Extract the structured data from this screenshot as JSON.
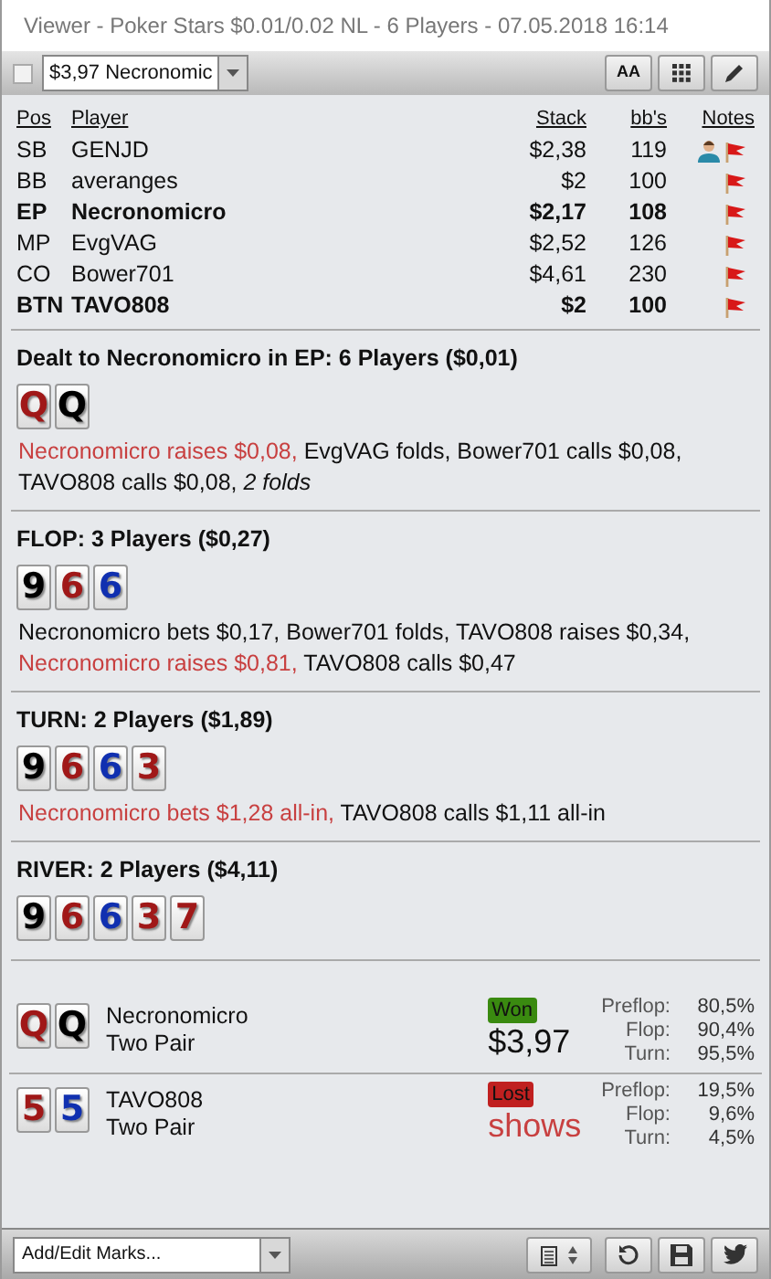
{
  "window": {
    "title": "Viewer - Poker Stars $0.01/0.02 NL - 6 Players - 07.05.2018 16:14"
  },
  "toolbar": {
    "checked": false,
    "hand_select": "$3,97 Necronomic",
    "font_button": "AA"
  },
  "players": {
    "columns": [
      "Pos",
      "Player",
      "Stack",
      "bb's",
      "Notes"
    ],
    "rows": [
      {
        "pos": "SB",
        "name": "GENJD",
        "stack": "$2,38",
        "bbs": "119",
        "hero": false,
        "note": true
      },
      {
        "pos": "BB",
        "name": "averanges",
        "stack": "$2",
        "bbs": "100",
        "hero": false,
        "note": false
      },
      {
        "pos": "EP",
        "name": "Necronomicro",
        "stack": "$2,17",
        "bbs": "108",
        "hero": true,
        "note": false
      },
      {
        "pos": "MP",
        "name": "EvgVAG",
        "stack": "$2,52",
        "bbs": "126",
        "hero": false,
        "note": false
      },
      {
        "pos": "CO",
        "name": "Bower701",
        "stack": "$4,61",
        "bbs": "230",
        "hero": false,
        "note": false
      },
      {
        "pos": "BTN",
        "name": "TAVO808",
        "stack": "$2",
        "bbs": "100",
        "hero": true,
        "note": false
      }
    ]
  },
  "streets": [
    {
      "heading": "Dealt to Necronomicro in EP: 6 Players ($0,01)",
      "cards": [
        {
          "rank": "Q",
          "color": "#a01818"
        },
        {
          "rank": "Q",
          "color": "#000000"
        }
      ],
      "actions": [
        {
          "text": "Necronomicro raises $0,08,",
          "kind": "hero"
        },
        {
          "text": "EvgVAG folds, Bower701 calls $0,08, TAVO808 calls $0,08,",
          "kind": "normal"
        },
        {
          "text": "2 folds",
          "kind": "italic"
        }
      ]
    },
    {
      "heading": "FLOP: 3 Players ($0,27)",
      "cards": [
        {
          "rank": "9",
          "color": "#000000"
        },
        {
          "rank": "6",
          "color": "#a01818"
        },
        {
          "rank": "6",
          "color": "#1030b0"
        }
      ],
      "actions": [
        {
          "text": "Necronomicro bets $0,17, Bower701 folds, TAVO808 raises $0,34,",
          "kind": "normal"
        },
        {
          "text": "Necronomicro raises $0,81,",
          "kind": "hero"
        },
        {
          "text": "TAVO808 calls $0,47",
          "kind": "normal"
        }
      ]
    },
    {
      "heading": "TURN: 2 Players ($1,89)",
      "cards": [
        {
          "rank": "9",
          "color": "#000000"
        },
        {
          "rank": "6",
          "color": "#a01818"
        },
        {
          "rank": "6",
          "color": "#1030b0"
        },
        {
          "rank": "3",
          "color": "#a01818"
        }
      ],
      "actions": [
        {
          "text": "Necronomicro bets $1,28 all-in,",
          "kind": "hero"
        },
        {
          "text": "TAVO808 calls $1,11 all-in",
          "kind": "normal"
        }
      ]
    },
    {
      "heading": "RIVER: 2 Players ($4,11)",
      "cards": [
        {
          "rank": "9",
          "color": "#000000"
        },
        {
          "rank": "6",
          "color": "#a01818"
        },
        {
          "rank": "6",
          "color": "#1030b0"
        },
        {
          "rank": "3",
          "color": "#a01818"
        },
        {
          "rank": "7",
          "color": "#a01818"
        }
      ]
    }
  ],
  "results": [
    {
      "cards": [
        {
          "rank": "Q",
          "color": "#a01818"
        },
        {
          "rank": "Q",
          "color": "#000000"
        }
      ],
      "name": "Necronomicro",
      "hand": "Two Pair",
      "won": true,
      "badge": "Won",
      "amount": "$3,97",
      "equity": [
        {
          "label": "Preflop:",
          "value": "80,5%"
        },
        {
          "label": "Flop:",
          "value": "90,4%"
        },
        {
          "label": "Turn:",
          "value": "95,5%"
        }
      ]
    },
    {
      "cards": [
        {
          "rank": "5",
          "color": "#a01818"
        },
        {
          "rank": "5",
          "color": "#1030b0"
        }
      ],
      "name": "TAVO808",
      "hand": "Two Pair",
      "won": false,
      "badge": "Lost",
      "amount": "shows",
      "equity": [
        {
          "label": "Preflop:",
          "value": "19,5%"
        },
        {
          "label": "Flop:",
          "value": "9,6%"
        },
        {
          "label": "Turn:",
          "value": "4,5%"
        }
      ]
    }
  ],
  "bottom": {
    "marks_placeholder": "Add/Edit Marks..."
  }
}
